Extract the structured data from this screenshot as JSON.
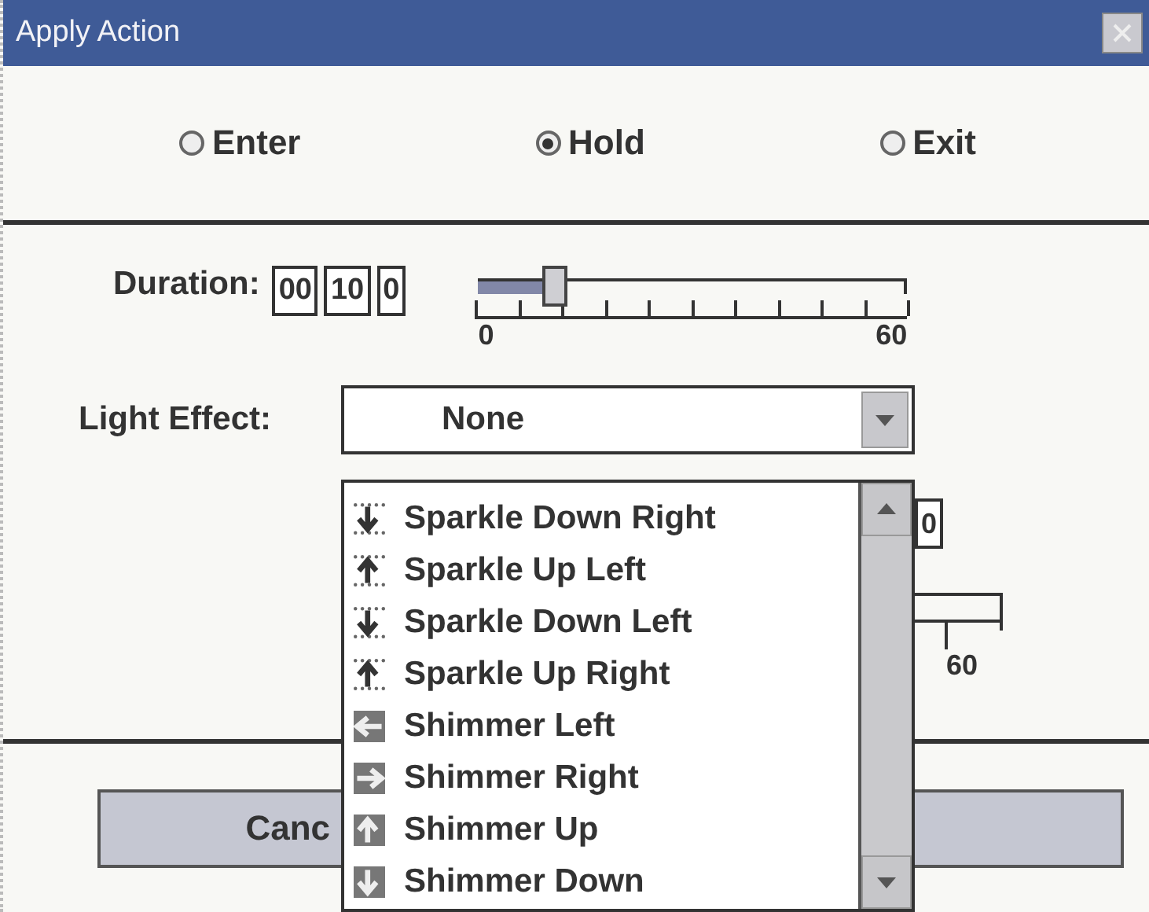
{
  "window": {
    "title": "Apply Action"
  },
  "phases": [
    {
      "label": "Enter",
      "selected": false
    },
    {
      "label": "Hold",
      "selected": true
    },
    {
      "label": "Exit",
      "selected": false
    }
  ],
  "duration": {
    "label": "Duration:",
    "fields": [
      "00",
      "10",
      "0"
    ],
    "slider": {
      "level": 0.17,
      "min_label": "0",
      "max_label": "60"
    }
  },
  "light_effect": {
    "label": "Light Effect:",
    "value": "None",
    "options": [
      {
        "label": "Sparkle Down Right",
        "kind": "sparkle-down"
      },
      {
        "label": "Sparkle Up Left",
        "kind": "sparkle-up"
      },
      {
        "label": "Sparkle Down Left",
        "kind": "sparkle-down"
      },
      {
        "label": "Sparkle Up Right",
        "kind": "sparkle-up"
      },
      {
        "label": "Shimmer Left",
        "kind": "shimmer-left"
      },
      {
        "label": "Shimmer Right",
        "kind": "shimmer-right"
      },
      {
        "label": "Shimmer Up",
        "kind": "shimmer-up"
      },
      {
        "label": "Shimmer Down",
        "kind": "shimmer-down"
      }
    ]
  },
  "covered_row": {
    "field": "0",
    "max_label": "60"
  },
  "buttons": [
    "Canc"
  ]
}
